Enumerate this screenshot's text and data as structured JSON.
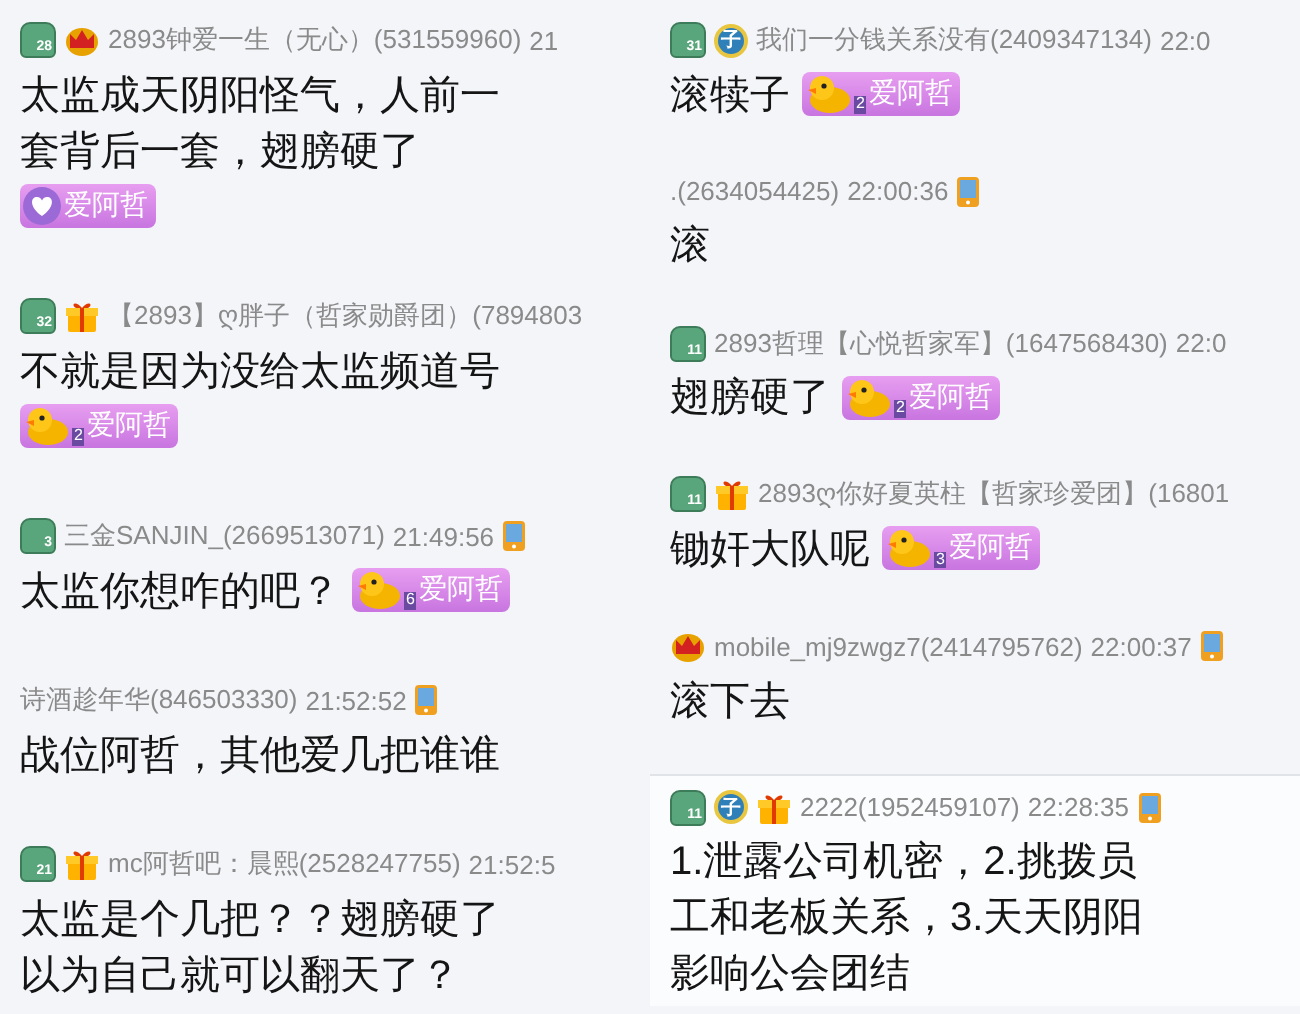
{
  "columns": [
    {
      "messages": [
        {
          "badges": [
            {
              "kind": "level",
              "label": "28"
            },
            {
              "kind": "crown"
            }
          ],
          "name": "2893钟爱一生（无心）(531559960)",
          "time": "21",
          "device": false,
          "framed": false,
          "lines": [
            {
              "text": "太监成天阴阳怪气，人前一"
            },
            {
              "text": "套背后一套，翅膀硬了"
            },
            {
              "sticker": {
                "kind": "heart",
                "label": "爱阿哲"
              }
            }
          ]
        },
        {
          "badges": [
            {
              "kind": "level",
              "label": "32"
            },
            {
              "kind": "gift"
            }
          ],
          "name": "【2893】ღ胖子（哲家勋爵团）(7894803",
          "device": false,
          "framed": false,
          "lines": [
            {
              "text": "不就是因为没给太监频道号"
            },
            {
              "sticker": {
                "kind": "duck",
                "level": "2",
                "label": "爱阿哲"
              }
            }
          ]
        },
        {
          "badges": [
            {
              "kind": "level",
              "label": "3"
            }
          ],
          "name": "三金SANJIN_(2669513071)",
          "time": "21:49:56",
          "device": true,
          "framed": false,
          "lines": [
            {
              "text": "太监你想咋的吧？",
              "sticker": {
                "kind": "duck",
                "level": "6",
                "label": "爱阿哲"
              }
            }
          ]
        },
        {
          "name": "诗酒趁年华(846503330)",
          "time": "21:52:52",
          "device": true,
          "framed": false,
          "lines": [
            {
              "text": "战位阿哲，其他爱几把谁谁"
            }
          ]
        },
        {
          "badges": [
            {
              "kind": "level",
              "label": "21"
            },
            {
              "kind": "gift"
            }
          ],
          "name": "mc阿哲吧：晨熙(2528247755)",
          "time": "21:52:5",
          "device": false,
          "framed": false,
          "lines": [
            {
              "text": "太监是个几把？？翅膀硬了"
            },
            {
              "text": "以为自己就可以翻天了？"
            }
          ]
        }
      ]
    },
    {
      "messages": [
        {
          "badges": [
            {
              "kind": "level",
              "label": "31"
            },
            {
              "kind": "role",
              "label": "子"
            }
          ],
          "name": "我们一分钱关系没有(2409347134)",
          "time": "22:0",
          "device": false,
          "framed": false,
          "lines": [
            {
              "text": "滚犊子",
              "sticker": {
                "kind": "duck",
                "level": "2",
                "label": "爱阿哲"
              }
            }
          ]
        },
        {
          "name": ".(2634054425)",
          "time": "22:00:36",
          "device": true,
          "framed": false,
          "lines": [
            {
              "text": "滚"
            }
          ]
        },
        {
          "badges": [
            {
              "kind": "level",
              "label": "11"
            }
          ],
          "name": "2893哲理【心悦哲家军】(1647568430)",
          "time": "22:0",
          "device": false,
          "framed": false,
          "lines": [
            {
              "text": "翅膀硬了",
              "sticker": {
                "kind": "duck",
                "level": "2",
                "label": "爱阿哲"
              }
            }
          ]
        },
        {
          "badges": [
            {
              "kind": "level",
              "label": "11"
            },
            {
              "kind": "gift"
            }
          ],
          "name": "2893ღ你好夏英柱【哲家珍爱团】(16801",
          "device": false,
          "framed": false,
          "lines": [
            {
              "text": "锄奸大队呢",
              "sticker": {
                "kind": "duck",
                "level": "3",
                "label": "爱阿哲"
              }
            }
          ]
        },
        {
          "badges": [
            {
              "kind": "crown"
            }
          ],
          "name": "mobile_mj9zwgz7(2414795762)",
          "time": "22:00:37",
          "device": true,
          "framed": false,
          "lines": [
            {
              "text": "滚下去"
            }
          ]
        },
        {
          "badges": [
            {
              "kind": "level",
              "label": "11"
            },
            {
              "kind": "role",
              "label": "子"
            },
            {
              "kind": "gift"
            }
          ],
          "name": "2222(1952459107)",
          "time": "22:28:35",
          "device": true,
          "framed": true,
          "lines": [
            {
              "text": "1.泄露公司机密，2.挑拨员"
            },
            {
              "text": "工和老板关系，3.天天阴阳"
            },
            {
              "text": "影响公会团结"
            }
          ]
        }
      ]
    }
  ]
}
